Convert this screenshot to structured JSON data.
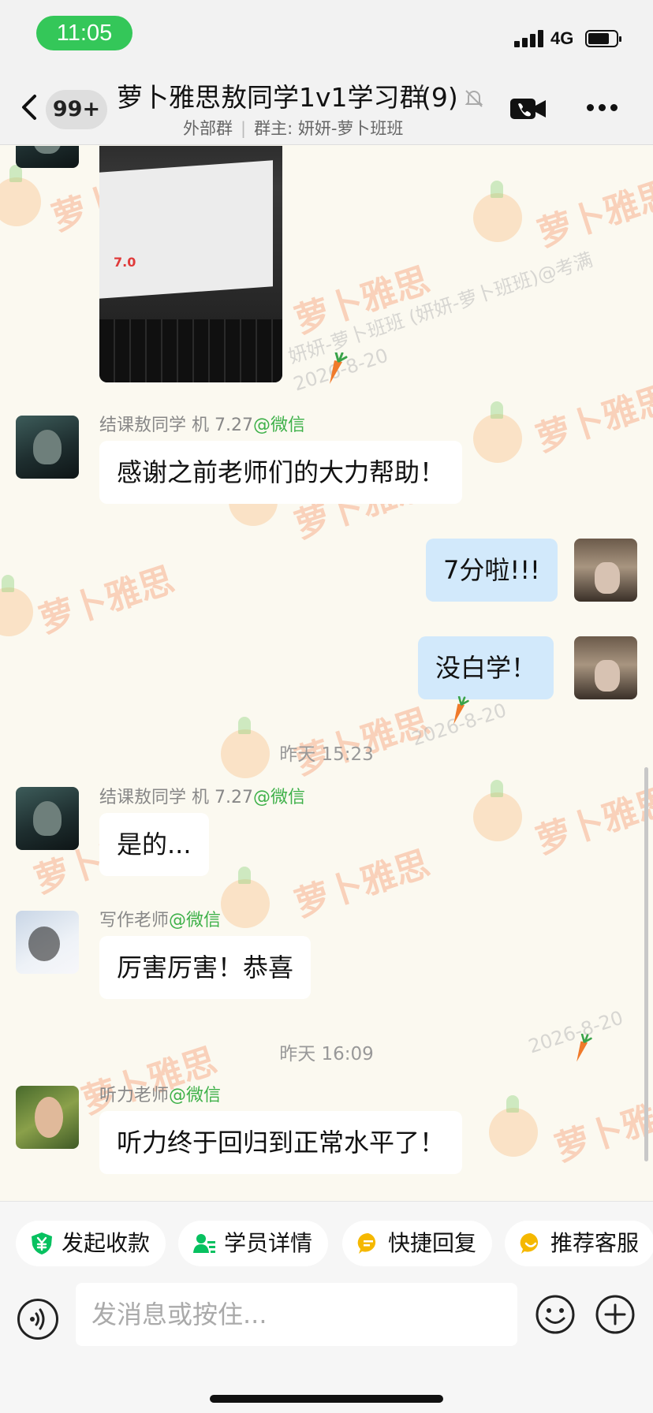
{
  "status_bar": {
    "time": "11:05",
    "network": "4G"
  },
  "header": {
    "unread_badge": "99+",
    "title": "萝卜雅思敖同学1v1学习群",
    "member_count": "(9)",
    "subtitle_type": "外部群",
    "subtitle_owner": "群主: 妍妍-萝卜班班"
  },
  "watermark": {
    "brand": "萝卜雅思",
    "line1": "妍妍-萝卜班班 (妍妍-萝卜班班)@考满",
    "date": "2026-8-20"
  },
  "photo_message": {
    "score": "7.0"
  },
  "messages": [
    {
      "sender": "结课敖同学 机 7.27",
      "source": "@微信",
      "text": "感谢之前老师们的大力帮助！"
    },
    {
      "self": true,
      "text": "7分啦!!!"
    },
    {
      "self": true,
      "text": "没白学！"
    },
    {
      "time": "昨天 15:23"
    },
    {
      "sender": "结课敖同学 机 7.27",
      "source": "@微信",
      "text": "是的..."
    },
    {
      "sender": "写作老师",
      "source": "@微信",
      "text": "厉害厉害！恭喜"
    },
    {
      "time": "昨天 16:09"
    },
    {
      "sender": "听力老师",
      "source": "@微信",
      "text": "听力终于回归到正常水平了！"
    }
  ],
  "quick_actions": [
    {
      "label": "发起收款",
      "icon": "yuan-shield-icon",
      "color": "#07c160"
    },
    {
      "label": "学员详情",
      "icon": "person-card-icon",
      "color": "#07c160"
    },
    {
      "label": "快捷回复",
      "icon": "reply-bubble-icon",
      "color": "#f5b800"
    },
    {
      "label": "推荐客服",
      "icon": "service-smile-icon",
      "color": "#f5b800"
    }
  ],
  "input": {
    "placeholder": "发消息或按住..."
  },
  "colors": {
    "accent_green": "#07c160",
    "bubble_self": "#d2e9fb",
    "status_pill": "#34c759"
  }
}
